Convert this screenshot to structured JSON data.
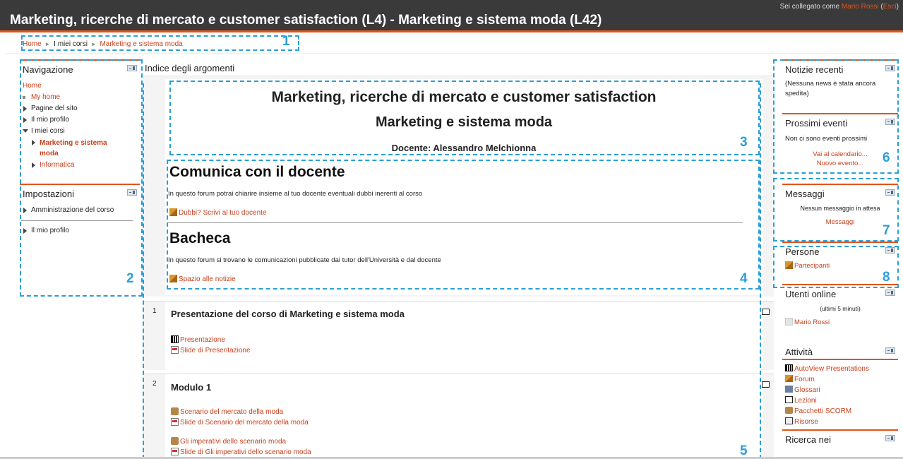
{
  "header": {
    "title": "Marketing, ricerche di mercato e customer satisfaction (L4) - Marketing e sistema moda (L42)",
    "login_text": "Sei collegato come",
    "login_user": "Mario Rossi",
    "logout": "Esci"
  },
  "breadcrumb": {
    "home": "Home",
    "my_courses": "I miei corsi",
    "current": "Marketing e sistema moda"
  },
  "navigation": {
    "title": "Navigazione",
    "home": "Home",
    "my_home": "My home",
    "site_pages": "Pagine del sito",
    "my_profile": "Il mio profilo",
    "my_courses": "I miei corsi",
    "course_active": "Marketing e sistema moda",
    "course_other": "Informatica"
  },
  "settings": {
    "title": "Impostazioni",
    "course_admin": "Amministrazione del corso",
    "my_profile": "Il mio profilo"
  },
  "main": {
    "topic_title": "Indice degli argomenti",
    "course_heading": "Marketing, ricerche di mercato e customer satisfaction",
    "course_sub": "Marketing e sistema moda",
    "teacher": "Docente: Alessandro Melchionna",
    "contact_heading": "Comunica con il docente",
    "contact_desc": "In questo forum potrai chiarire insieme al tuo docente eventuali dubbi inerenti al corso",
    "contact_link": "Dubbi? Scrivi al tuo docente",
    "board_heading": "Bacheca",
    "board_desc": "In questo forum si trovano le comunicazioni pubblicate dai tutor dell'Università e dal docente",
    "board_link": "Spazio alle notizie",
    "section1": {
      "num": "1",
      "title": "Presentazione del corso di Marketing e sistema moda",
      "items": [
        "Presentazione",
        "Slide di Presentazione"
      ]
    },
    "section2": {
      "num": "2",
      "title": "Modulo 1",
      "items": [
        "Scenario del mercato della moda",
        "Slide di Scenario del mercato della moda",
        "Gli imperativi dello scenario moda",
        "Slide di Gli imperativi dello scenario moda"
      ]
    }
  },
  "right": {
    "news_title": "Notizie recenti",
    "news_text": "(Nessuna news è stata ancora spedita)",
    "events_title": "Prossimi eventi",
    "events_text": "Non ci sono eventi prossimi",
    "calendar_link": "Vai al calendario...",
    "new_event_link": "Nuovo evento...",
    "messages_title": "Messaggi",
    "messages_text": "Nessun messaggio in attesa",
    "messages_link": "Messaggi",
    "people_title": "Persone",
    "people_link": "Partecipanti",
    "online_title": "Utenti online",
    "online_sub": "(ultimi 5 minuti)",
    "online_user": "Mario Rossi",
    "activity_title": "Attività",
    "activities": [
      "AutoView Presentations",
      "Forum",
      "Glossari",
      "Lezioni",
      "Pacchetti SCORM",
      "Risorse"
    ],
    "next_block_partial": "Ricerca nei"
  },
  "annotations": [
    "1",
    "2",
    "3",
    "4",
    "5",
    "6",
    "7",
    "8"
  ],
  "colors": {
    "accent": "#e2541c",
    "link": "#c8401c",
    "annotation": "#2c9ed8",
    "header_bg": "#3a3a3a"
  }
}
